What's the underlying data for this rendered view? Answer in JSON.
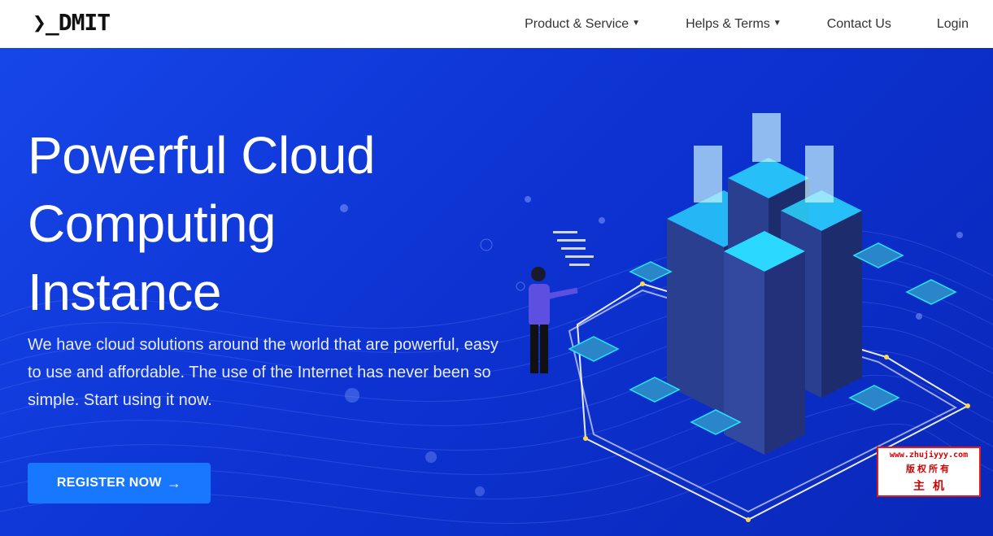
{
  "header": {
    "logo_text": "❯_DMIT",
    "nav": [
      {
        "label": "Product & Service",
        "has_dropdown": true
      },
      {
        "label": "Helps & Terms",
        "has_dropdown": true
      },
      {
        "label": "Contact Us",
        "has_dropdown": false
      },
      {
        "label": "Login",
        "has_dropdown": false
      }
    ]
  },
  "hero": {
    "title_line1": "Powerful Cloud",
    "title_line2": "Computing",
    "title_line3": "Instance",
    "description": "We have cloud solutions around the world that are powerful, easy to use and affordable. The use of the Internet has never been so simple. Start using it now.",
    "cta_label": "REGISTER NOW",
    "cta_icon": "arrow-right-icon"
  },
  "watermark": {
    "line1": "www.zhujiyyy.com",
    "line2": "版权所有",
    "line3": "主机"
  },
  "colors": {
    "hero_bg": "#0d33d3",
    "cta_bg": "#1877ff",
    "accent_cyan": "#23f1ff",
    "watermark_red": "#d10000"
  }
}
